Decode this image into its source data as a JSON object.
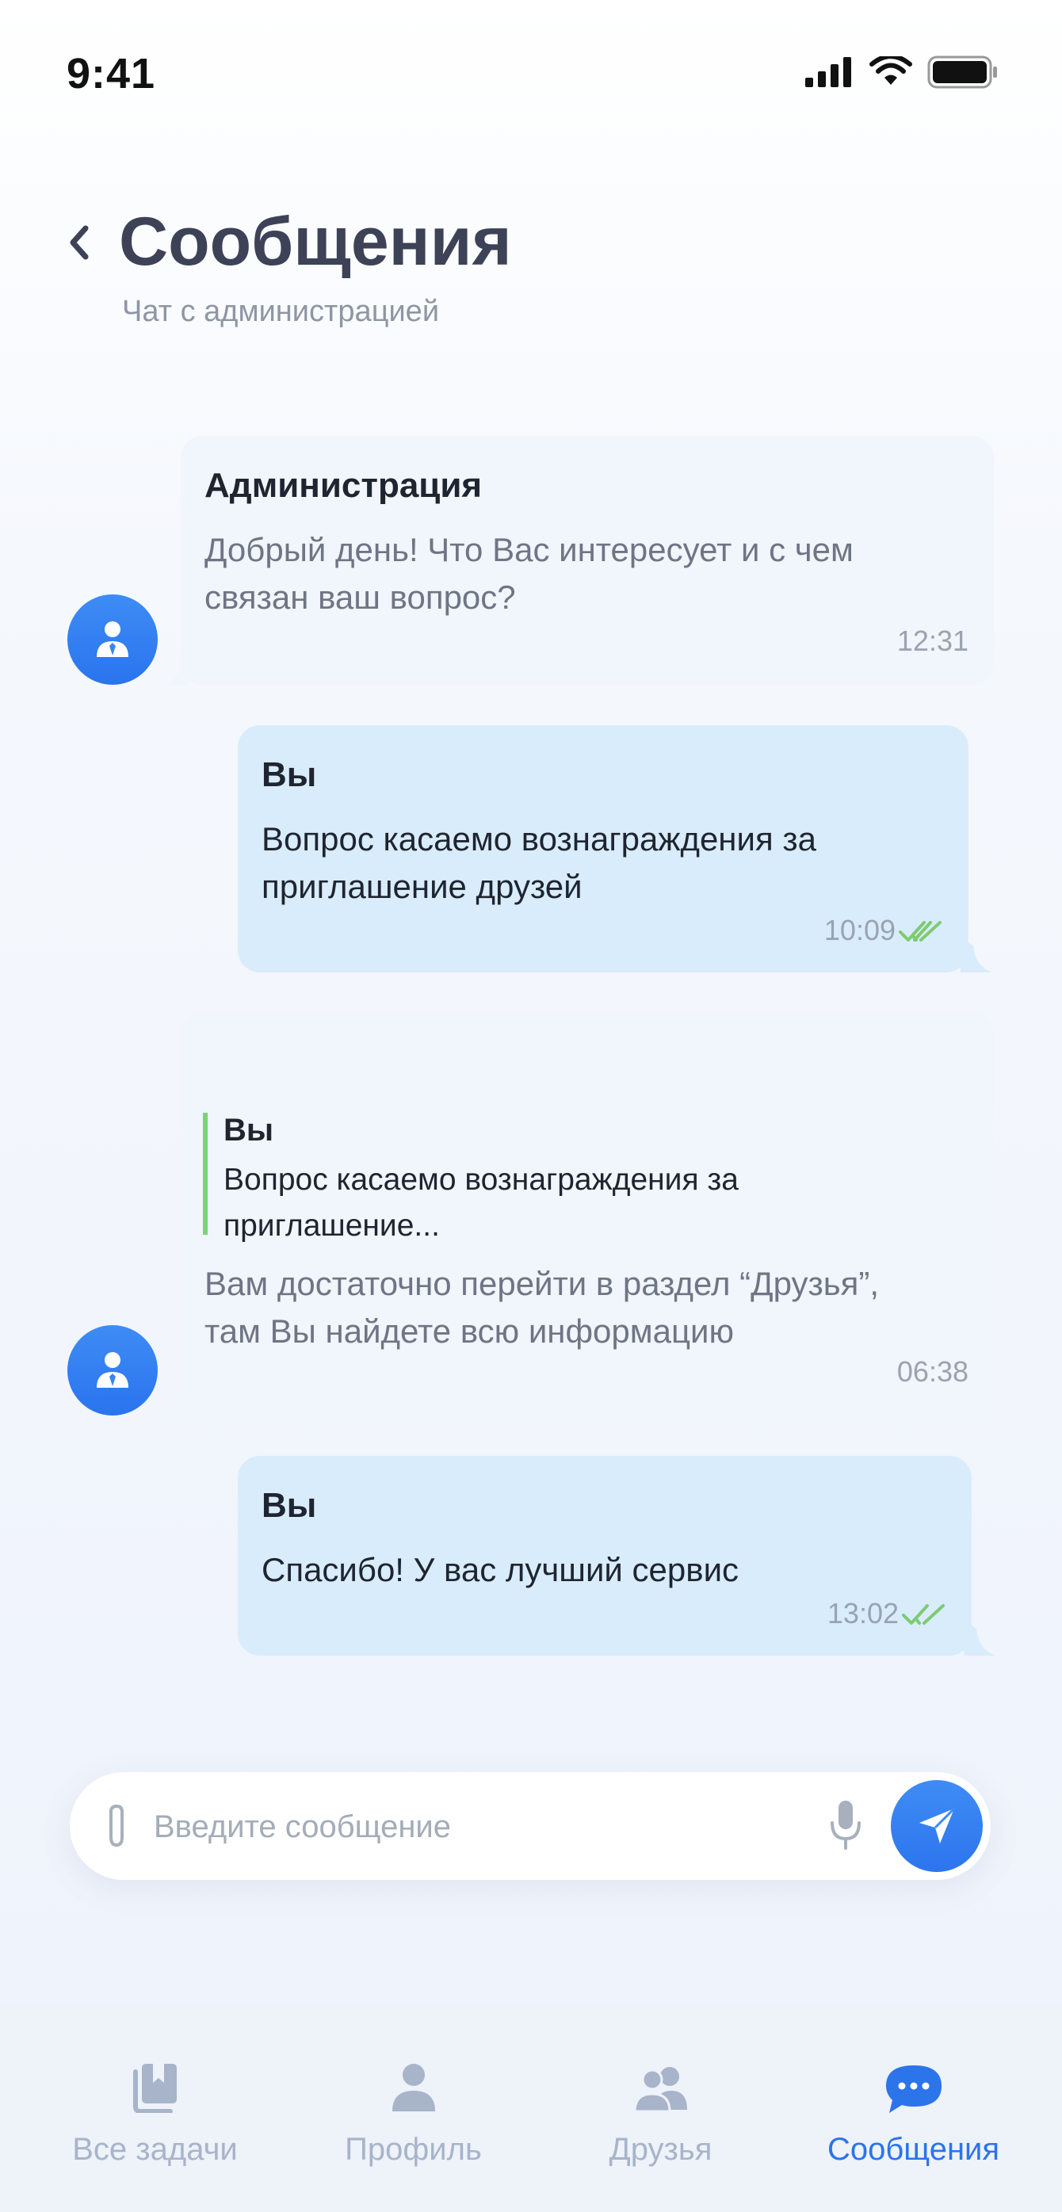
{
  "status_bar": {
    "time": "9:41"
  },
  "header": {
    "title": "Сообщения",
    "subtitle": "Чат с администрацией"
  },
  "messages": [
    {
      "sender": "Администрация",
      "text": "Добрый день! Что Вас интересует и с чем\nсвязан ваш вопрос?",
      "time": "12:31",
      "from": "admin"
    },
    {
      "sender": "Вы",
      "text": "Вопрос касаемо вознаграждения за\nприглашение друзей",
      "time": "10:09",
      "from": "me",
      "status": "read"
    },
    {
      "sender": "",
      "quote": {
        "sender": "Вы",
        "text": "Вопрос касаемо вознаграждения за\nприглашение..."
      },
      "text": "Вам достаточно перейти в раздел “Друзья”,\nтам Вы найдете всю информацию",
      "time": "06:38",
      "from": "admin"
    },
    {
      "sender": "Вы",
      "text": "Спасибо! У вас лучший сервис",
      "time": "13:02",
      "from": "me",
      "status": "read"
    }
  ],
  "composer": {
    "placeholder": "Введите сообщение",
    "value": ""
  },
  "tab_bar": {
    "items": [
      {
        "label": "Все задачи",
        "icon": "bookmarks-icon",
        "active": false
      },
      {
        "label": "Профиль",
        "icon": "person-icon",
        "active": false
      },
      {
        "label": "Друзья",
        "icon": "people-icon",
        "active": false
      },
      {
        "label": "Сообщения",
        "icon": "chat-bubble-icon",
        "active": true
      }
    ]
  },
  "colors": {
    "accent": "#2c74ea",
    "admin_bubble": "#f1f5fc",
    "my_bubble": "#d9ecfc",
    "read_ticks": "#7ecb72",
    "tab_inactive": "#a7b4ca"
  }
}
